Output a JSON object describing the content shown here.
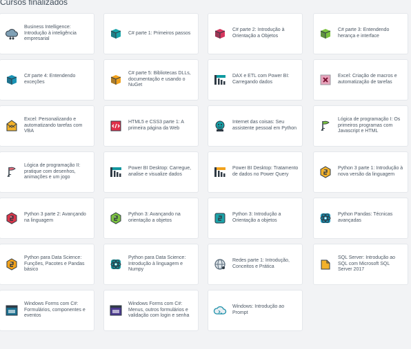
{
  "section_title": "Cursos finalizados",
  "courses": [
    {
      "label": "Business Intelligence: Introdução à inteligência empresarial",
      "icon": "cloud-network-icon",
      "color": "#7fa0b5"
    },
    {
      "label": "C# parte 1: Primeiros passos",
      "icon": "cube-icon",
      "color": "#18a4a8"
    },
    {
      "label": "C# parte 2: Introdução à Orientação a Objetos",
      "icon": "cube-icon",
      "color": "#d6365e"
    },
    {
      "label": "C# parte 3: Entendendo herança e interface",
      "icon": "cube-icon",
      "color": "#7cc240"
    },
    {
      "label": "C# parte 4: Entendendo exceções",
      "icon": "cube-icon",
      "color": "#1a93b5"
    },
    {
      "label": "C# parte 5: Bibliotecas DLLs, documentação e usando o NuGet",
      "icon": "cube-icon",
      "color": "#f2a21c"
    },
    {
      "label": "DAX e ETL com Power BI: Carregando dados",
      "icon": "bar-chart-icon",
      "color": "#0e9aa0"
    },
    {
      "label": "Excel: Criação de macros e automatização de tarefas",
      "icon": "excel-x-icon",
      "color": "#d04a7a"
    },
    {
      "label": "Excel: Personalizando e automatizando tarefas com VBA",
      "icon": "envelope-icon",
      "color": "#f2b12a"
    },
    {
      "label": "HTML5 e CSS3 parte 1: A primeira página da Web",
      "icon": "html-page-icon",
      "color": "#e0304a"
    },
    {
      "label": "Internet das coisas: Seu assistente pessoal em Python",
      "icon": "robot-icon",
      "color": "#16a0a6"
    },
    {
      "label": "Lógica de programação I: Os primeiros programas com Javascript e HTML",
      "icon": "flag-icon",
      "color": "#7cc240"
    },
    {
      "label": "Lógica de programação II: pratique com desenhos, animações e um jogo",
      "icon": "flag-icon",
      "color": "#e06a7a"
    },
    {
      "label": "Power BI Desktop: Carregue, analise e visualize dados",
      "icon": "bar-chart-icon",
      "color": "#13979f"
    },
    {
      "label": "Power BI Desktop: Tratamento de dados no Power Query",
      "icon": "bar-chart-icon",
      "color": "#f2a21c"
    },
    {
      "label": "Python 3 parte 1: Introdução à nova versão da linguagem",
      "icon": "python-hex-icon",
      "color": "#f2b12a"
    },
    {
      "label": "Python 3 parte 2: Avançando na linguagem",
      "icon": "python-hex-icon",
      "color": "#d9364a"
    },
    {
      "label": "Python 3: Avançando na orientação a objetos",
      "icon": "python-hex-icon",
      "color": "#7cc240"
    },
    {
      "label": "Python 3: Introdução a Orientação a objetos",
      "icon": "python-square-icon",
      "color": "#1ca3a8"
    },
    {
      "label": "Python Pandas: Técnicas avançadas",
      "icon": "atom-icon",
      "color": "#1a93b5"
    },
    {
      "label": "Python para Data Science: Funções, Pacotes e Pandas básico",
      "icon": "python-hex-icon",
      "color": "#f2a21c"
    },
    {
      "label": "Python para Data Science: Introdução à linguagem e Numpy",
      "icon": "atom-icon",
      "color": "#13979f"
    },
    {
      "label": "Redes parte 1: Introdução, Conceitos e Prática",
      "icon": "globe-network-icon",
      "color": "#5e6f7e"
    },
    {
      "label": "SQL Server: Introdução ao SQL com Microsoft SQL Server 2017",
      "icon": "database-icon",
      "color": "#f2b12a"
    },
    {
      "label": "Windows Forms com C#: Formulários, componentes e eventos",
      "icon": "window-icon",
      "color": "#1a6f8f"
    },
    {
      "label": "Windows Forms com C#: Menus, outros formulários e validação com login e senha",
      "icon": "window-icon",
      "color": "#4b3a8f"
    },
    {
      "label": "Windows: Introdução ao Prompt",
      "icon": "cloud-icon",
      "color": "#1a8fa8"
    }
  ]
}
